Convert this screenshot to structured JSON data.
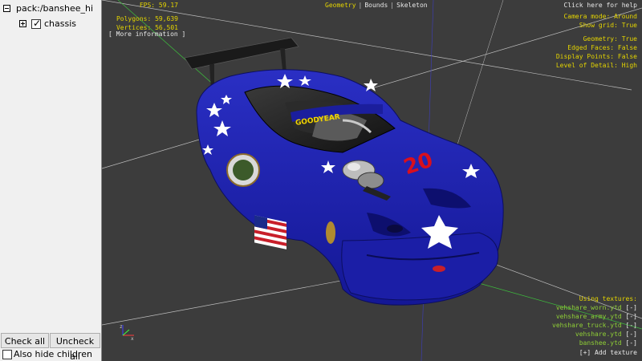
{
  "tree": {
    "root_label": "pack:/banshee_hi",
    "child_label": "chassis",
    "child_checked": true
  },
  "buttons": {
    "check_all": "Check all",
    "uncheck_all": "Uncheck all",
    "hide_children": "Also hide children"
  },
  "viewport": {
    "stats": {
      "fps": "FPS: 59.17",
      "polygons": "Polygons: 59,639",
      "vertices": "Vertices: 56,501"
    },
    "more_info": "[ More information ]",
    "tabs": [
      "Geometry",
      "Bounds",
      "Skeleton"
    ],
    "active_tab": "Geometry",
    "help": "Click here for help",
    "settings": {
      "camera_mode": "Camera mode: Around",
      "show_grid": "Show grid: True",
      "geometry": "Geometry: True",
      "edged_faces": "Edged Faces: False",
      "display_points": "Display Points: False",
      "level_of_detail": "Level of Detail: High"
    },
    "textures": {
      "header": "Using textures:",
      "items": [
        {
          "name": "vehshare_worn.ytd",
          "remove": "[-]"
        },
        {
          "name": "vehshare_army.ytd",
          "remove": "[-]"
        },
        {
          "name": "vehshare_truck.ytd",
          "remove": "[-]"
        },
        {
          "name": "vehshare.ytd",
          "remove": "[-]"
        },
        {
          "name": "banshee.ytd",
          "remove": "[-]"
        }
      ],
      "add": "[+] Add texture"
    },
    "livery_number": "20",
    "windshield_text": "GOODYEAR",
    "colors": {
      "hud_yellow": "#e4d400",
      "hud_green": "#8fcf36",
      "car_blue": "#1c1fa8",
      "background": "#3c3c3c"
    }
  }
}
